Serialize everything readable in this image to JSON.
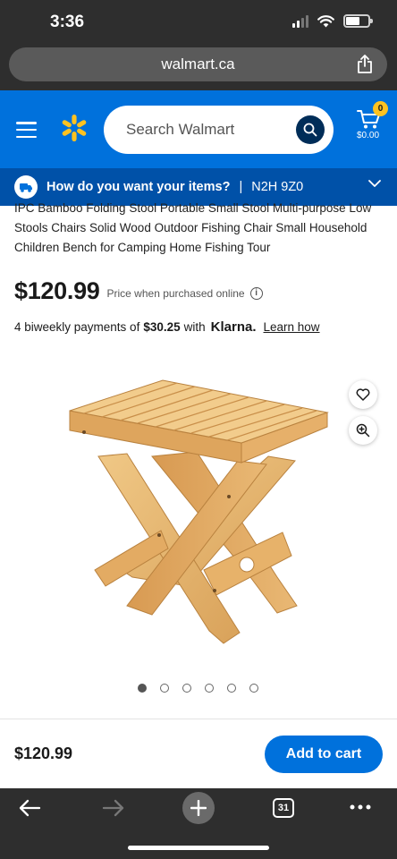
{
  "status_bar": {
    "time": "3:36"
  },
  "browser": {
    "url": "walmart.ca",
    "tab_count": "31"
  },
  "header": {
    "search_placeholder": "Search Walmart",
    "cart_count": "0",
    "cart_total": "$0.00",
    "brand_color": "#0071dc",
    "spark_color": "#ffc220"
  },
  "delivery": {
    "question": "How do you want your items?",
    "separator": "|",
    "postal_code": "N2H 9Z0"
  },
  "product": {
    "title": "IPC Bamboo Folding Stool Portable Small Stool Multi-purpose Low Stools Chairs Solid Wood Outdoor Fishing Chair Small Household Children Bench for Camping Home Fishing Tour",
    "price": "$120.99",
    "price_note": "Price when purchased online",
    "info_glyph": "i",
    "klarna": {
      "prefix": "4 biweekly payments of",
      "amount": "$30.25",
      "with": "with",
      "brand": "Klarna.",
      "link": "Learn how"
    },
    "carousel": {
      "total": 6,
      "active": 0
    }
  },
  "sticky": {
    "price": "$120.99",
    "add_to_cart": "Add to cart"
  },
  "icons": [
    "menu-icon",
    "spark-logo-icon",
    "search-icon",
    "cart-icon",
    "truck-icon",
    "chevron-down-icon",
    "heart-icon",
    "zoom-in-icon",
    "back-icon",
    "forward-icon",
    "new-tab-icon",
    "more-icon",
    "share-icon"
  ]
}
